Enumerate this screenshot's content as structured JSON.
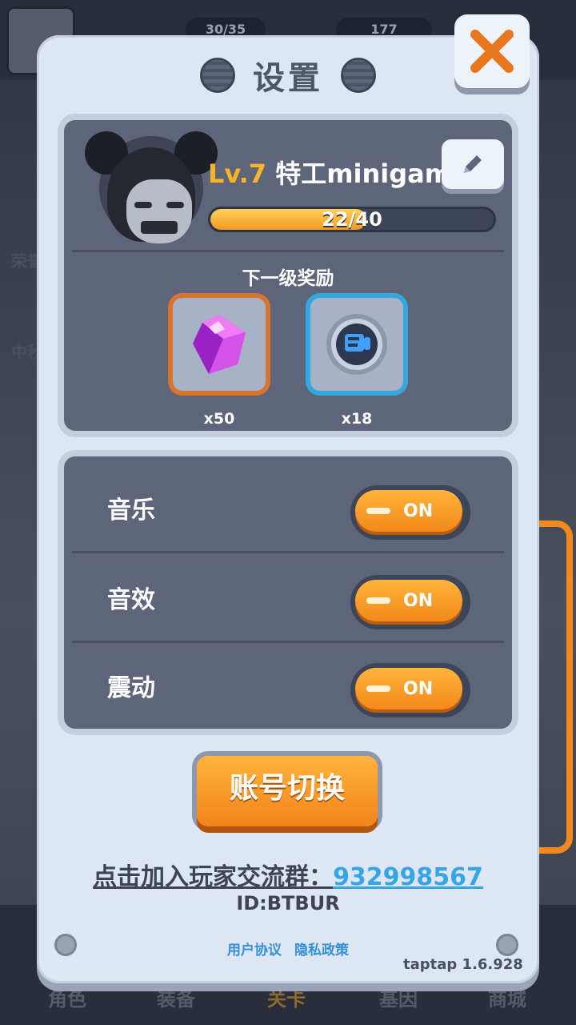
{
  "background": {
    "stats": [
      "30/35",
      "177"
    ],
    "side_labels": [
      "荣誉",
      "中秋"
    ],
    "bottom_tabs": [
      "角色",
      "装备",
      "关卡",
      "基因",
      "商城"
    ],
    "active_tab": "关卡"
  },
  "dialog": {
    "title": "设置",
    "close_icon": "close-x-icon"
  },
  "profile": {
    "level": "Lv.7",
    "name": "特工minigam",
    "xp_text": "22/40",
    "xp_fraction": 0.55,
    "edit_icon": "pencil-icon",
    "next_reward_title": "下一级奖励",
    "rewards": [
      {
        "icon": "purple-gem-icon",
        "qty": "x50"
      },
      {
        "icon": "fist-token-icon",
        "qty": "x18"
      }
    ]
  },
  "settings": {
    "rows": [
      {
        "label": "音乐",
        "state": "ON"
      },
      {
        "label": "音效",
        "state": "ON"
      },
      {
        "label": "震动",
        "state": "ON"
      }
    ]
  },
  "account": {
    "switch_label": "账号切换",
    "group_label": "点击加入玩家交流群：",
    "group_number": "932998567",
    "id_text": "ID:BTBUR"
  },
  "footer": {
    "user_agreement": "用户协议",
    "privacy_policy": "隐私政策",
    "version": "taptap 1.6.928"
  },
  "colors": {
    "accent_orange": "#f3891a",
    "link_blue": "#35a5e6",
    "level_gold": "#f5b526",
    "panel_bg": "#dde6f2",
    "box_bg": "#5e6479"
  }
}
